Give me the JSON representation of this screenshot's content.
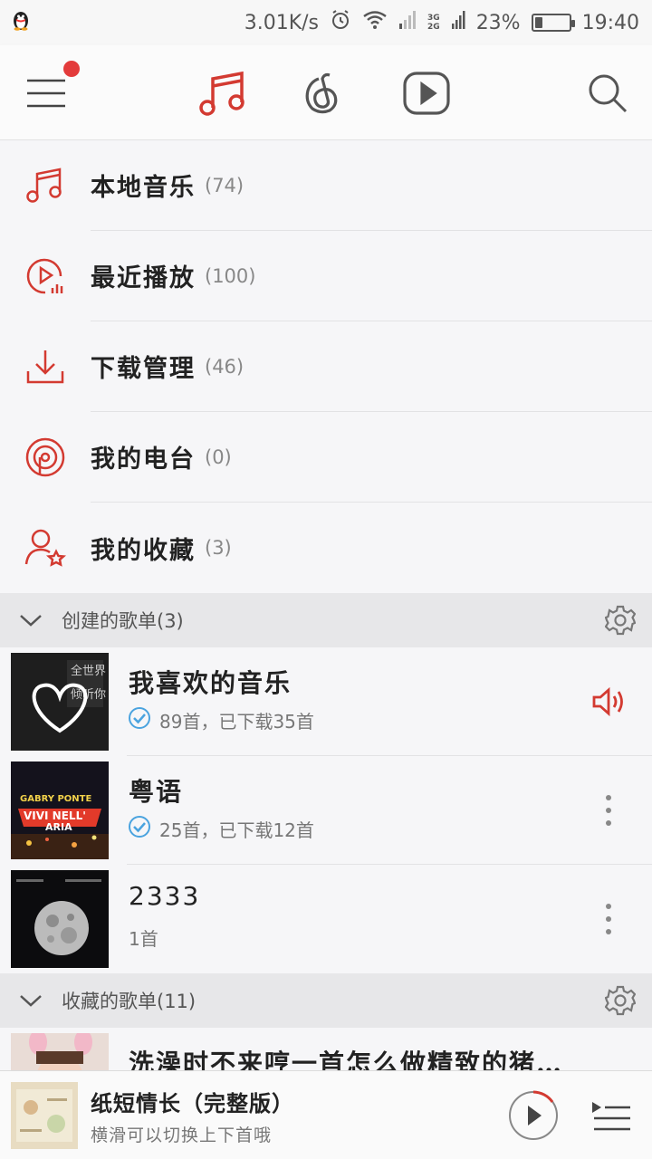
{
  "status_bar": {
    "speed": "3.01K/s",
    "net_top": "3G",
    "net_bottom": "2G",
    "battery_percent": "23%",
    "battery_level": 0.23,
    "time": "19:40"
  },
  "topbar": {
    "icons": [
      "hamburger-menu-icon",
      "music-note-icon",
      "netease-logo-icon",
      "video-play-icon",
      "search-icon"
    ],
    "active_color": "#d33a31",
    "has_notification": true
  },
  "menu": {
    "items": [
      {
        "label": "本地音乐",
        "count": "(74)",
        "icon": "music-note-icon"
      },
      {
        "label": "最近播放",
        "count": "(100)",
        "icon": "recent-play-icon"
      },
      {
        "label": "下载管理",
        "count": "(46)",
        "icon": "download-icon"
      },
      {
        "label": "我的电台",
        "count": "(0)",
        "icon": "radio-icon"
      },
      {
        "label": "我的收藏",
        "count": "(3)",
        "icon": "user-star-icon"
      }
    ]
  },
  "created_playlists": {
    "title": "创建的歌单(3)",
    "items": [
      {
        "title": "我喜欢的音乐",
        "subtitle": "89首，已下载35首",
        "downloaded": true,
        "action": "speaker-icon",
        "cover_text": "全世界 谁倾听你"
      },
      {
        "title": "粤语",
        "subtitle": "25首，已下载12首",
        "downloaded": true,
        "action": "more-icon",
        "cover_text": "GABRY PONTE VIVI NELL' ARIA"
      },
      {
        "title": "2333",
        "subtitle": "1首",
        "downloaded": false,
        "action": "more-icon"
      }
    ]
  },
  "collected_playlists": {
    "title": "收藏的歌单(11)",
    "items": [
      {
        "title": "洗澡时不来哼一首怎么做精致的猪…"
      }
    ]
  },
  "player": {
    "title": "纸短情长（完整版）",
    "subtitle": "横滑可以切换上下首哦"
  },
  "colors": {
    "accent": "#d33a31",
    "download_check": "#4aa3df"
  }
}
